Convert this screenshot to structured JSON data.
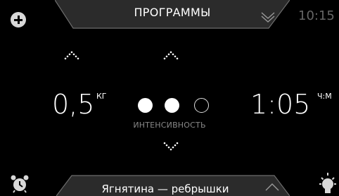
{
  "header": {
    "title": "ПРОГРАММЫ",
    "clock": "10:15",
    "add_icon": "plus-circle-icon",
    "expand_icon": "double-chevron-down-icon"
  },
  "weight": {
    "value": "0,5",
    "unit": "КГ"
  },
  "time": {
    "value": "1:05",
    "unit": "Ч:М"
  },
  "intensity": {
    "label": "ИНТЕНСИВНОСТЬ",
    "level": 2,
    "max": 3
  },
  "footer": {
    "program": "Ягнятина — ребрышки",
    "collapse_icon": "chevron-up-icon",
    "alarm_icon": "alarm-clock-icon",
    "light_icon": "light-bulb-icon"
  },
  "colors": {
    "background": "#000000",
    "text": "#ffffff",
    "muted": "#888888",
    "tab_fill": "#2a2a2a",
    "tab_border": "#6a6a6a"
  }
}
